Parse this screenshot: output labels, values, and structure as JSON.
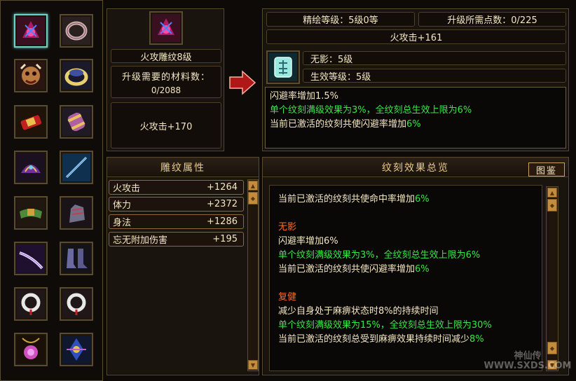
{
  "engrave": {
    "name": "火攻雕纹8级",
    "material_label": "升级需要的材料数：",
    "material_value": "0/2088",
    "current_attr": "火攻击+170"
  },
  "upgrade": {
    "refine_level": "精绘等级：5级0等",
    "points_needed": "升级所需点数：0/225",
    "next_attr": "火攻击+161",
    "rune_name": "无影：5级",
    "effect_level": "生效等级：5级",
    "desc_white1": "闪避率增加1.5%",
    "desc_green1": "单个纹刻满级效果为3%，全纹刻总生效上限为6%",
    "desc_white2": "当前已激活的纹刻共使闪避率增加",
    "desc_green2": "6%"
  },
  "attributes": {
    "title": "雕纹属性",
    "rows": [
      {
        "name": "火攻击",
        "value": "+1264"
      },
      {
        "name": "体力",
        "value": "+2372"
      },
      {
        "name": "身法",
        "value": "+1286"
      },
      {
        "name": "忘无附加伤害",
        "value": "+195"
      }
    ]
  },
  "summary": {
    "title": "纹刻效果总览",
    "guide_button": "图鉴",
    "line1_white": "当前已激活的纹刻共使命中率增加",
    "line1_green": "6%",
    "sec2_title": "无影",
    "sec2_white1": "闪避率增加6%",
    "sec2_green": "单个纹刻满级效果为3%，全纹刻总生效上限为6%",
    "sec2_white2": "当前已激活的纹刻共使闪避率增加",
    "sec2_green2": "6%",
    "sec3_title": "复健",
    "sec3_white1": "减少自身处于麻痹状态时8%的持续时间",
    "sec3_green": "单个纹刻满级效果为15%，全纹刻总生效上限为30%",
    "sec3_white2": "当前已激活的纹刻总受到麻痹效果持续时间减少",
    "sec3_green2": "8%"
  },
  "watermark": "神仙传 WWW.SXDS.COM",
  "equipment_icons": [
    "fire-engrave-icon",
    "ring-icon",
    "demon-mask-icon",
    "bracelet-icon",
    "belt-scroll-icon",
    "cuff-icon",
    "purple-helm-icon",
    "blue-sword-icon",
    "green-belt-icon",
    "gauntlet-icon",
    "purple-blade-icon",
    "boots-icon",
    "jade-pendant-icon",
    "jade-pendant-icon",
    "amulet-icon",
    "blue-ornament-icon"
  ]
}
